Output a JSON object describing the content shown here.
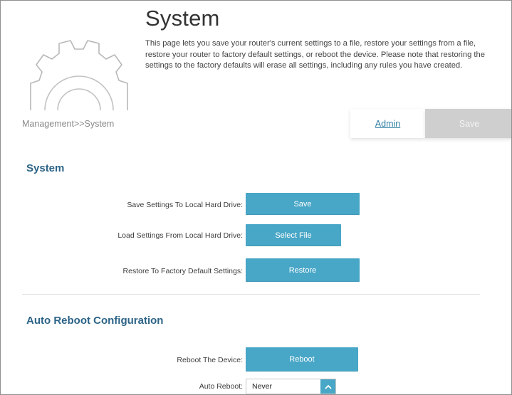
{
  "header": {
    "title": "System",
    "description": "This page lets you save your router's current settings to a file, restore your settings from a file, restore your router to factory default settings, or reboot the device. Please note that restoring the settings to the factory defaults will erase all settings, including any rules you have created."
  },
  "breadcrumb": "Management>>System",
  "topnav": {
    "admin_label": "Admin",
    "save_label": "Save"
  },
  "system_section": {
    "title": "System",
    "rows": [
      {
        "label": "Save Settings To Local Hard Drive:",
        "button": "Save"
      },
      {
        "label": "Load Settings From Local Hard Drive:",
        "button": "Select File"
      },
      {
        "label": "Restore To Factory Default Settings:",
        "button": "Restore"
      }
    ]
  },
  "reboot_section": {
    "title": "Auto Reboot Configuration",
    "reboot_label": "Reboot The Device:",
    "reboot_button": "Reboot",
    "auto_reboot_label": "Auto Reboot:",
    "auto_reboot_value": "Never"
  },
  "icons": {
    "header": "gear-icon",
    "select": "chevron-up-icon"
  },
  "colors": {
    "accent": "#48a6c6",
    "section_title": "#2c6387",
    "link": "#2f7fa4",
    "disabled_button": "#cfcfcf"
  }
}
